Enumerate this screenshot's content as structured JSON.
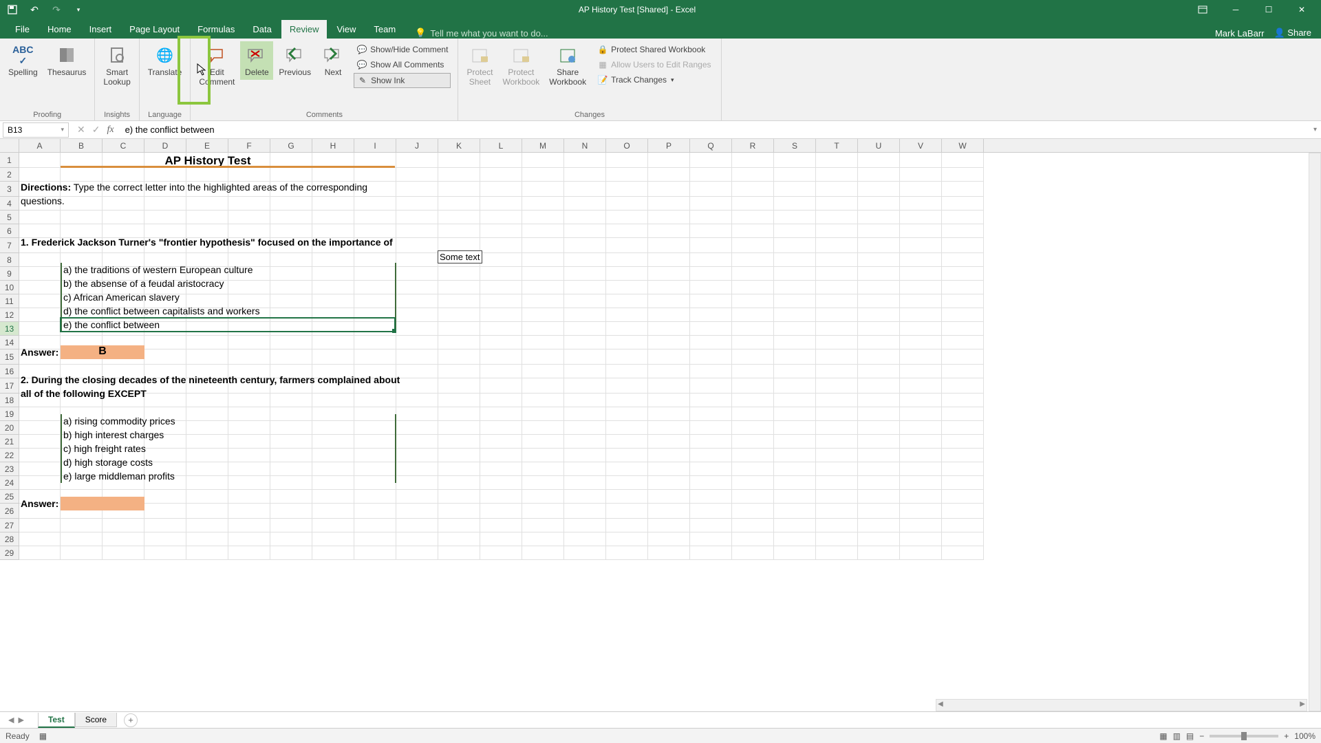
{
  "title": "AP History Test  [Shared] - Excel",
  "user": "Mark LaBarr",
  "share_label": "Share",
  "tabs": [
    "File",
    "Home",
    "Insert",
    "Page Layout",
    "Formulas",
    "Data",
    "Review",
    "View",
    "Team"
  ],
  "active_tab": "Review",
  "tellme_placeholder": "Tell me what you want to do...",
  "ribbon": {
    "proofing": {
      "spelling": "Spelling",
      "thesaurus": "Thesaurus",
      "group": "Proofing"
    },
    "insights": {
      "smart_lookup": "Smart\nLookup",
      "group": "Insights"
    },
    "language": {
      "translate": "Translate",
      "group": "Language"
    },
    "comments": {
      "edit": "Edit\nComment",
      "delete": "Delete",
      "previous": "Previous",
      "next": "Next",
      "show_hide": "Show/Hide Comment",
      "show_all": "Show All Comments",
      "show_ink": "Show Ink",
      "group": "Comments"
    },
    "changes": {
      "protect_sheet": "Protect\nSheet",
      "protect_workbook": "Protect\nWorkbook",
      "share_workbook": "Share\nWorkbook",
      "protect_shared": "Protect Shared Workbook",
      "allow_edit": "Allow Users to Edit Ranges",
      "track": "Track Changes",
      "group": "Changes"
    }
  },
  "name_box": "B13",
  "formula_value": "e) the conflict between",
  "columns": [
    "A",
    "B",
    "C",
    "D",
    "E",
    "F",
    "G",
    "H",
    "I",
    "J",
    "K",
    "L",
    "M",
    "N",
    "O",
    "P",
    "Q",
    "R",
    "S",
    "T",
    "U",
    "V",
    "W"
  ],
  "row_count": 29,
  "selected_row": 13,
  "sheet": {
    "title_cell": "AP History Test",
    "directions_label": "Directions:",
    "directions_text": " Type the correct letter into the highlighted areas of the corresponding",
    "directions_text2": "questions.",
    "q1": "1. Frederick Jackson Turner's \"frontier hypothesis\" focused on the importance of",
    "q1_opts": [
      "a) the traditions of western European culture",
      "b) the absense of a feudal aristocracy",
      "c) African American slavery",
      "d) the conflict between capitalists and workers",
      "e) the conflict between"
    ],
    "answer_label": "Answer:",
    "answer1": "B",
    "q2a": "2. During the closing decades of the nineteenth century, farmers complained about",
    "q2b": "all of the following EXCEPT",
    "q2_opts": [
      "a) rising commodity prices",
      "b) high interest charges",
      "c) high freight rates",
      "d) high storage costs",
      "e) large middleman profits"
    ],
    "answer2": ""
  },
  "comment_text": "Some text",
  "sheet_tabs": [
    "Test",
    "Score"
  ],
  "active_sheet": "Test",
  "status": "Ready",
  "zoom": "100%"
}
